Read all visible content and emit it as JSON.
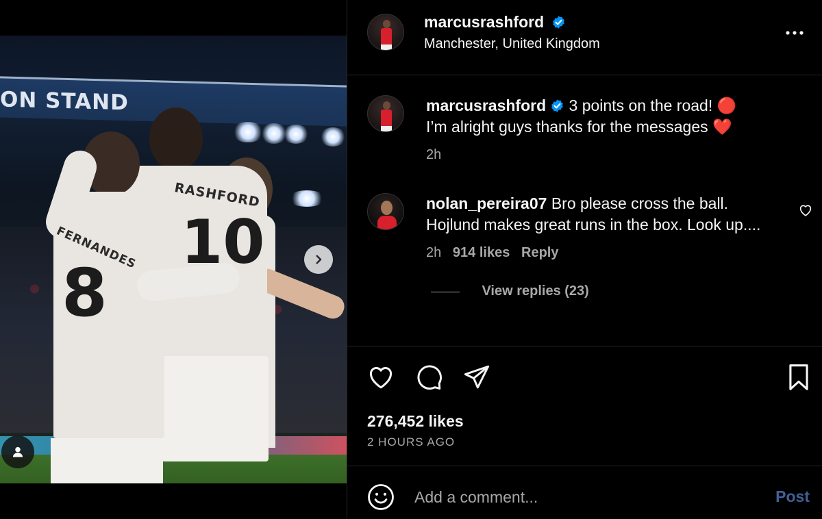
{
  "media": {
    "stand_text": "ON STAND",
    "jersey_left_name": "FERNANDES",
    "jersey_left_number": "8",
    "jersey_right_name": "RASHFORD",
    "jersey_right_number": "10",
    "carousel": {
      "total": 3,
      "active": 1
    }
  },
  "post": {
    "author": "marcusrashford",
    "verified": true,
    "location": "Manchester, United Kingdom",
    "caption_line1": "3 points on the road! 🔴",
    "caption_line2": "I’m alright guys thanks for the messages ❤️",
    "caption_time": "2h"
  },
  "comments": [
    {
      "user": "nolan_pereira07",
      "text": "Bro please cross the ball. Hojlund makes great runs in the box. Look up....",
      "time": "2h",
      "likes": "914 likes",
      "reply_label": "Reply",
      "view_replies": "View replies (23)"
    }
  ],
  "actions": {
    "likes_count": "276,452 likes",
    "time_ago": "2 HOURS AGO"
  },
  "composer": {
    "placeholder": "Add a comment...",
    "post_label": "Post"
  },
  "colors": {
    "verified_badge": "#0095f6",
    "post_button": "#41609a",
    "secondary_text": "#a8a8a8",
    "divider": "#262626"
  }
}
